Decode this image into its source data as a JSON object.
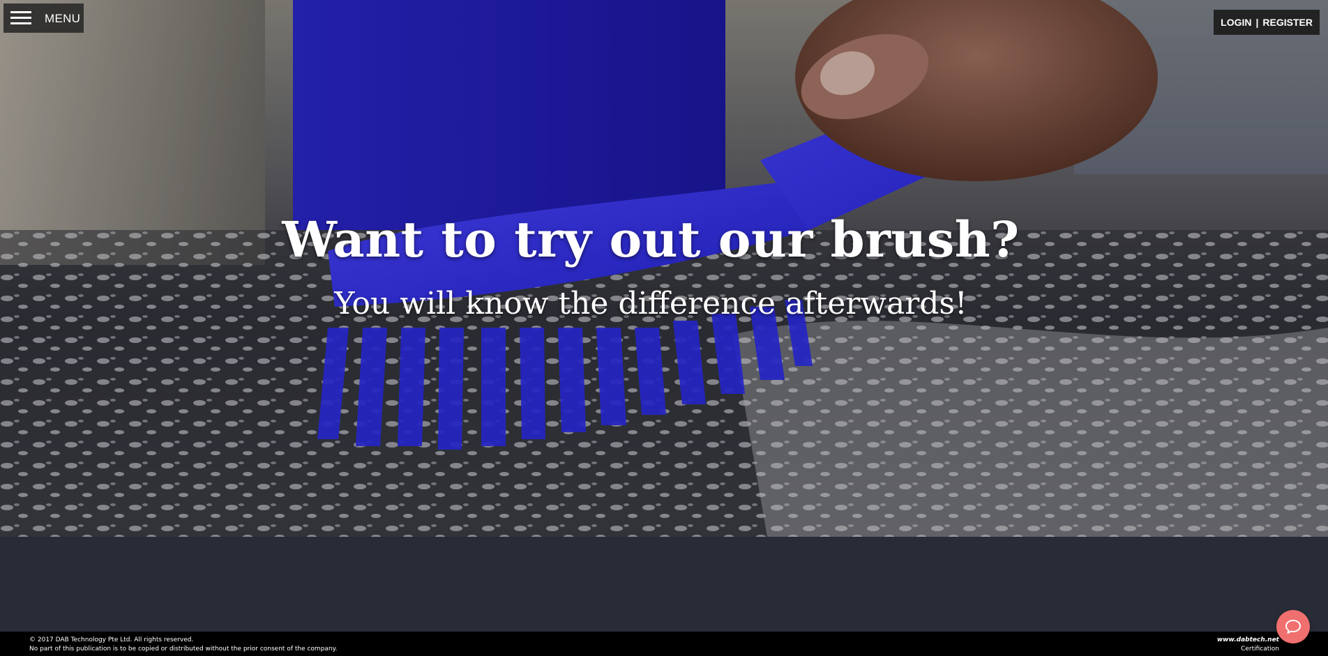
{
  "header": {
    "menu_label": "MENU",
    "login_label": "LOGIN",
    "separator": "|",
    "register_label": "REGISTER"
  },
  "hero": {
    "headline": "Want to try out our brush?",
    "subheadline": "You will know the difference afterwards!"
  },
  "footer": {
    "copyright": "© 2017 DAB Technology Pte Ltd. All rights reserved.",
    "notice": "No part of this publication is to be copied or distributed without the prior consent of the company.",
    "website": "www.dabtech.net",
    "certification": "Certification"
  },
  "icons": {
    "menu": "hamburger-icon",
    "chat": "chat-bubble-icon"
  },
  "colors": {
    "brush_blue": "#2d2ee0",
    "lower_band": "#272c36",
    "footer_bg": "#000000",
    "chat_button": "#f06f6f"
  }
}
